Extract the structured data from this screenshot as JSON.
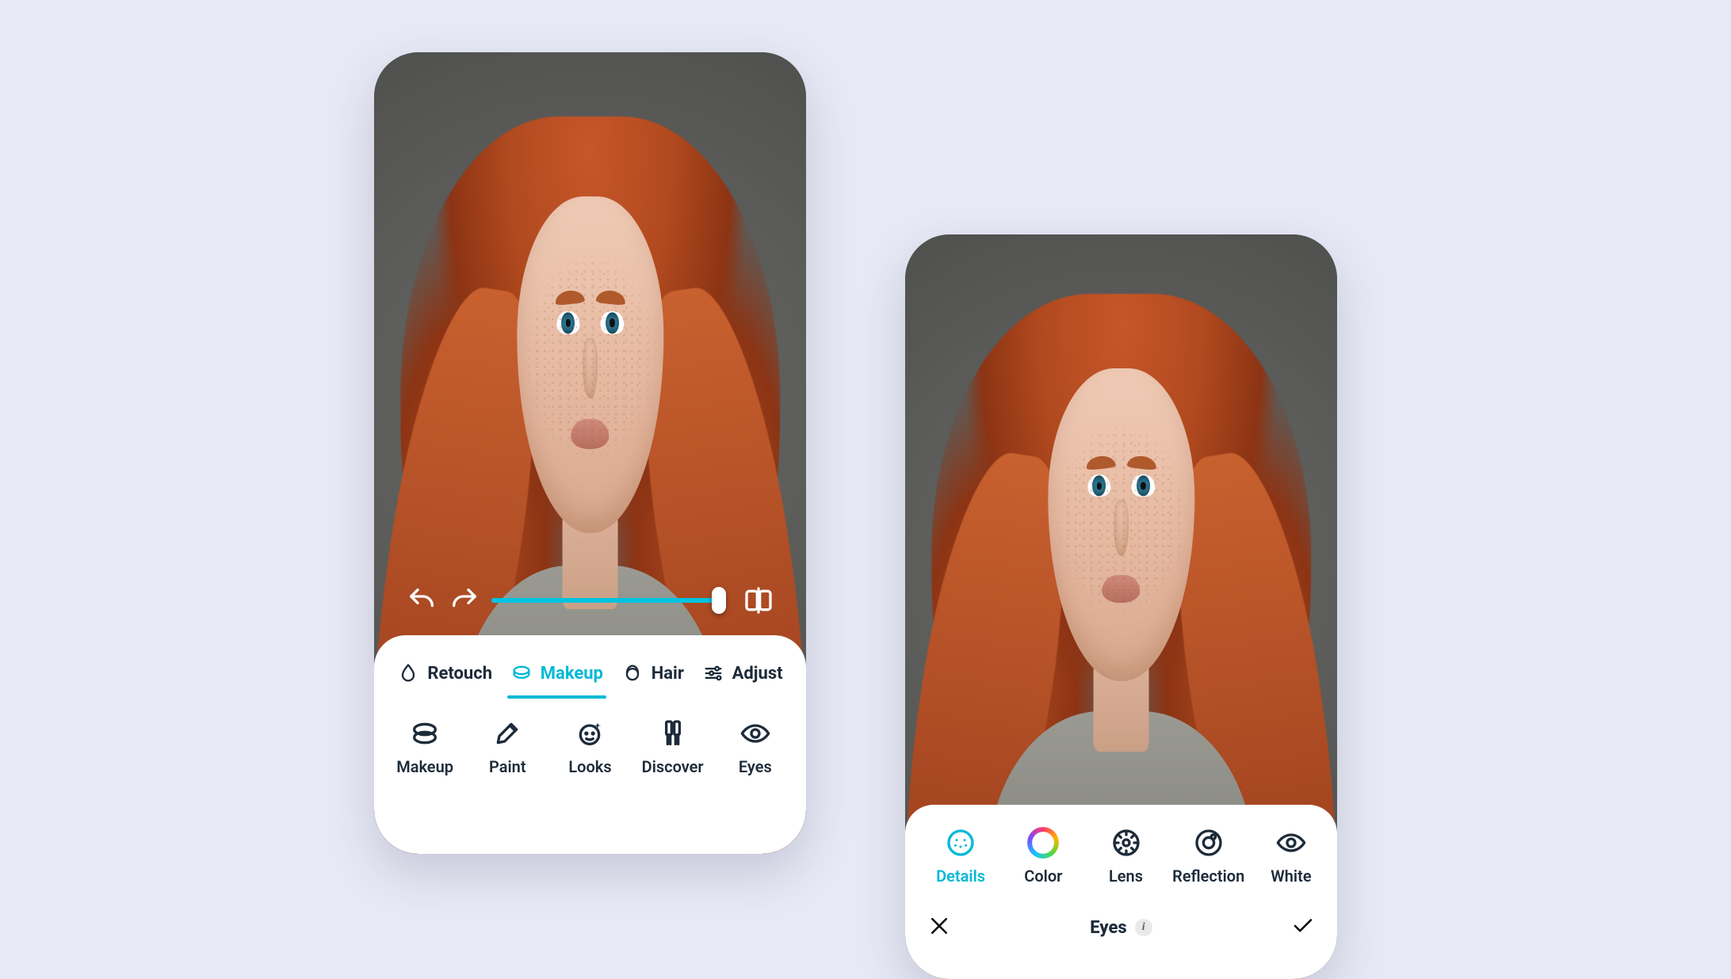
{
  "colors": {
    "accent": "#00b9d6",
    "text": "#1d2b3a"
  },
  "left": {
    "slider": {
      "percent": 100
    },
    "tabs": [
      {
        "label": "Retouch",
        "icon": "drop-icon",
        "active": false
      },
      {
        "label": "Makeup",
        "icon": "makeup-icon",
        "active": true
      },
      {
        "label": "Hair",
        "icon": "hair-icon",
        "active": false
      },
      {
        "label": "Adjust",
        "icon": "sliders-icon",
        "active": false
      }
    ],
    "tools": [
      {
        "label": "Makeup",
        "icon": "compact-icon"
      },
      {
        "label": "Paint",
        "icon": "brush-icon"
      },
      {
        "label": "Looks",
        "icon": "sparkle-face-icon"
      },
      {
        "label": "Discover",
        "icon": "double-brush-icon"
      },
      {
        "label": "Eyes",
        "icon": "eye-icon"
      }
    ],
    "controls": {
      "undo": "undo-icon",
      "redo": "redo-icon",
      "compare": "compare-icon"
    }
  },
  "right": {
    "section_title": "Eyes",
    "subtools": [
      {
        "label": "Details",
        "icon": "dots-circle-icon",
        "active": true
      },
      {
        "label": "Color",
        "icon": "color-ring-icon",
        "active": false
      },
      {
        "label": "Lens",
        "icon": "lens-icon",
        "active": false
      },
      {
        "label": "Reflection",
        "icon": "reflection-icon",
        "active": false
      },
      {
        "label": "White",
        "icon": "eye-icon",
        "active": false
      }
    ],
    "actions": {
      "cancel": "close-icon",
      "confirm": "check-icon",
      "info": "info-icon"
    }
  }
}
